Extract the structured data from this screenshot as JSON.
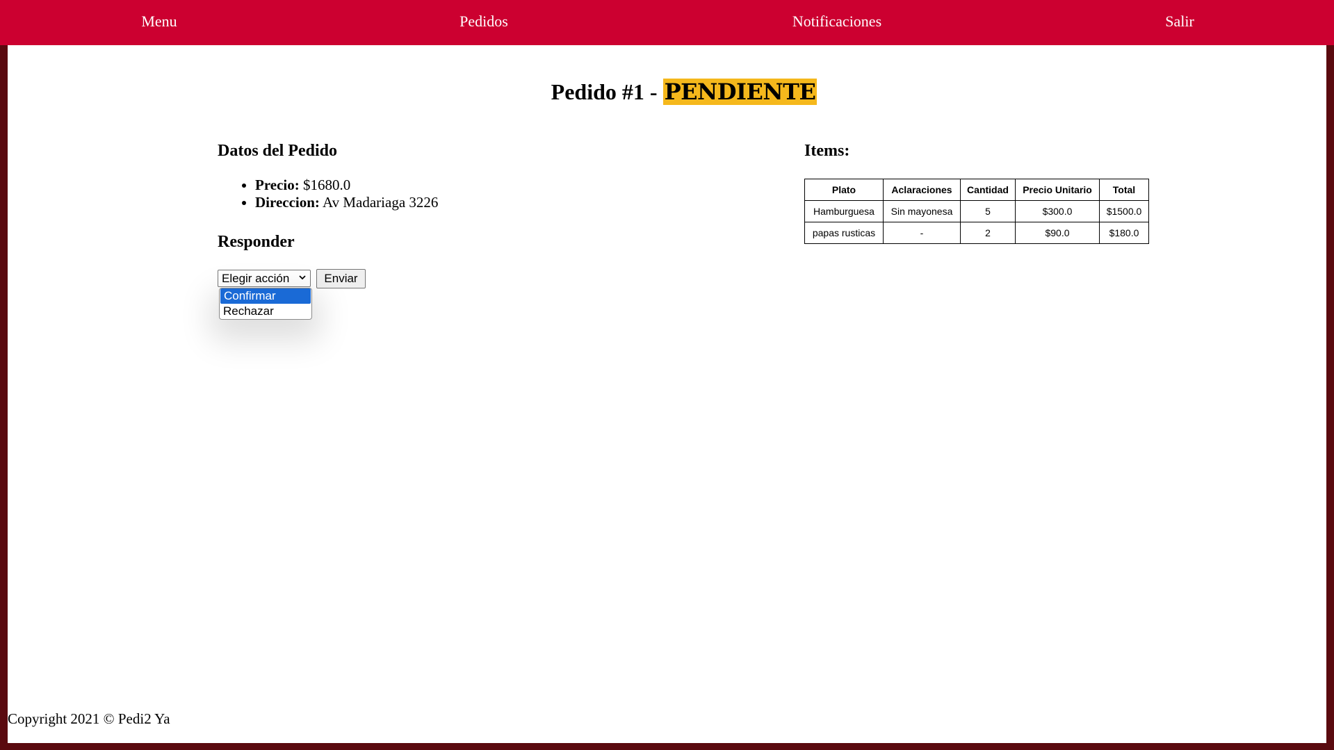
{
  "nav": {
    "items": [
      "Menu",
      "Pedidos",
      "Notificaciones",
      "Salir"
    ]
  },
  "order": {
    "title_prefix": "Pedido #1 - ",
    "status": "PENDIENTE",
    "status_color": "#f5b81c"
  },
  "details": {
    "heading": "Datos del Pedido",
    "precio_label": "Precio:",
    "precio_value": " $1680.0",
    "direccion_label": "Direccion:",
    "direccion_value": " Av Madariaga 3226"
  },
  "respond": {
    "heading": "Responder",
    "select_value": "Elegir acción",
    "submit_label": "Enviar",
    "options": [
      "Confirmar",
      "Rechazar"
    ],
    "highlighted_option": "Confirmar"
  },
  "items": {
    "heading": "Items:",
    "columns": [
      "Plato",
      "Aclaraciones",
      "Cantidad",
      "Precio Unitario",
      "Total"
    ],
    "rows": [
      [
        "Hamburguesa",
        "Sin mayonesa",
        "5",
        "$300.0",
        "$1500.0"
      ],
      [
        "papas rusticas",
        "-",
        "2",
        "$90.0",
        "$180.0"
      ]
    ]
  },
  "footer": {
    "text": "Copyright 2021 © Pedi2 Ya"
  },
  "colors": {
    "navbar": "#cc0030",
    "frame": "#5a0a0f",
    "option_highlight": "#1a6ad6"
  }
}
